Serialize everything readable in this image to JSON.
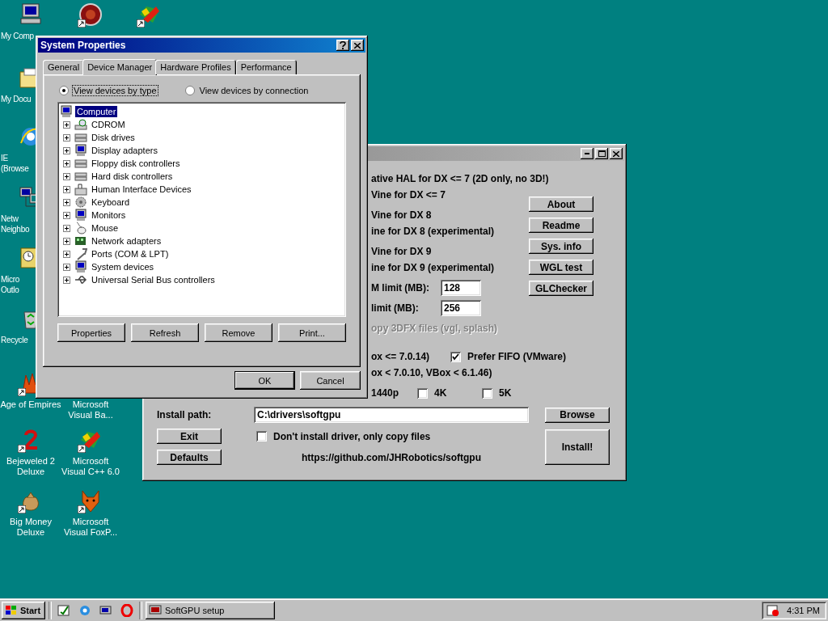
{
  "desktop_icons": [
    {
      "label": "My Comp",
      "kind": "computer",
      "shortcut": false
    },
    {
      "label": "My Docu",
      "kind": "folder",
      "shortcut": false
    },
    {
      "label": "IE\n(Browse",
      "kind": "browser",
      "shortcut": false
    },
    {
      "label": "Netw\nNeighbo",
      "kind": "network",
      "shortcut": false
    },
    {
      "label": "Micro\nOutlo",
      "kind": "mail",
      "shortcut": false
    },
    {
      "label": "Recycle",
      "kind": "recycle",
      "shortcut": false
    },
    {
      "label": "Age of Empires",
      "kind": "game",
      "shortcut": true
    },
    {
      "label": "Bejeweled 2\nDeluxe",
      "kind": "gem",
      "shortcut": true
    },
    {
      "label": "Big Money\nDeluxe",
      "kind": "money",
      "shortcut": true
    },
    {
      "kind": "disc",
      "shortcut": true
    },
    {
      "label": "Microsoft\nVisual Ba...",
      "kind": "none"
    },
    {
      "label": "Microsoft\nVisual C++ 6.0",
      "kind": "studio",
      "shortcut": true
    },
    {
      "label": "Microsoft\nVisual FoxP...",
      "kind": "fox",
      "shortcut": true
    },
    {
      "kind": "studio",
      "shortcut": true
    }
  ],
  "system_properties": {
    "title": "System Properties",
    "tabs": [
      {
        "label": "General",
        "selected": false
      },
      {
        "label": "Device Manager",
        "selected": true
      },
      {
        "label": "Hardware Profiles",
        "selected": false
      },
      {
        "label": "Performance",
        "selected": false
      }
    ],
    "view_options": [
      {
        "label": "View devices by type",
        "selected": true
      },
      {
        "label": "View devices by connection",
        "selected": false
      }
    ],
    "tree": {
      "label": "Computer",
      "selected": true,
      "children": [
        {
          "label": "CDROM",
          "kind": "cdrom",
          "expanded": false
        },
        {
          "label": "Disk drives",
          "kind": "disk",
          "expanded": false
        },
        {
          "label": "Display adapters",
          "kind": "monitor",
          "expanded": false
        },
        {
          "label": "Floppy disk controllers",
          "kind": "disk",
          "expanded": false
        },
        {
          "label": "Hard disk controllers",
          "kind": "disk",
          "expanded": false
        },
        {
          "label": "Human Interface Devices",
          "kind": "hid",
          "expanded": false
        },
        {
          "label": "Keyboard",
          "kind": "keyboard",
          "expanded": false
        },
        {
          "label": "Monitors",
          "kind": "monitor",
          "expanded": false
        },
        {
          "label": "Mouse",
          "kind": "mouse",
          "expanded": false
        },
        {
          "label": "Network adapters",
          "kind": "network",
          "expanded": false
        },
        {
          "label": "Ports (COM & LPT)",
          "kind": "port",
          "expanded": false
        },
        {
          "label": "System devices",
          "kind": "monitor",
          "expanded": false
        },
        {
          "label": "Universal Serial Bus controllers",
          "kind": "usb",
          "expanded": false
        }
      ]
    },
    "buttons": [
      "Properties",
      "Refresh",
      "Remove",
      "Print..."
    ],
    "footer_buttons": [
      {
        "label": "OK",
        "default": true
      },
      {
        "label": "Cancel",
        "default": false
      }
    ]
  },
  "softgpu": {
    "rows": [
      {
        "kind": "text",
        "label": "ative HAL for DX <= 7 (2D only, no 3D!)",
        "disabled": false
      },
      {
        "kind": "text",
        "label": "Vine for DX <= 7",
        "disabled": false
      },
      {
        "kind": "text",
        "label": "Vine for DX 8",
        "disabled": false
      },
      {
        "kind": "text",
        "label": "ine for DX 8 (experimental)",
        "disabled": false
      },
      {
        "kind": "text",
        "label": "Vine for DX 9",
        "disabled": false
      },
      {
        "kind": "text",
        "label": "ine for DX 9 (experimental)",
        "disabled": false
      },
      {
        "kind": "field",
        "label": "M limit (MB):",
        "value": "128"
      },
      {
        "kind": "field",
        "label": "limit (MB):",
        "value": "256"
      },
      {
        "kind": "text",
        "label": "opy 3DFX files (vgl, splash)",
        "disabled": true
      },
      {
        "kind": "checks",
        "label": "ox <= 7.0.14)",
        "checks": [
          {
            "label": "Prefer FIFO (VMware)",
            "checked": true
          }
        ]
      },
      {
        "kind": "text",
        "label": "ox < 7.0.10, VBox < 6.1.46)",
        "disabled": false
      },
      {
        "kind": "checks",
        "label": "1440p",
        "checks": [
          {
            "label": "4K",
            "checked": false
          },
          {
            "label": "5K",
            "checked": false
          }
        ]
      }
    ],
    "side_buttons": [
      "About",
      "Readme",
      "Sys. info",
      "WGL test",
      "GLChecker"
    ],
    "install_path": {
      "label": "Install path:",
      "value": "C:\\drivers\\softgpu"
    },
    "browse": "Browse",
    "exit": "Exit",
    "defaults": "Defaults",
    "copy_only": {
      "label": "Don't install driver, only copy files",
      "checked": false
    },
    "link": "https://github.com/JHRobotics/softgpu",
    "install": "Install!"
  },
  "taskbar": {
    "start": "Start",
    "tasks": [
      {
        "label": "SoftGPU setup",
        "selected": false
      }
    ],
    "clock": "4:31 PM"
  }
}
